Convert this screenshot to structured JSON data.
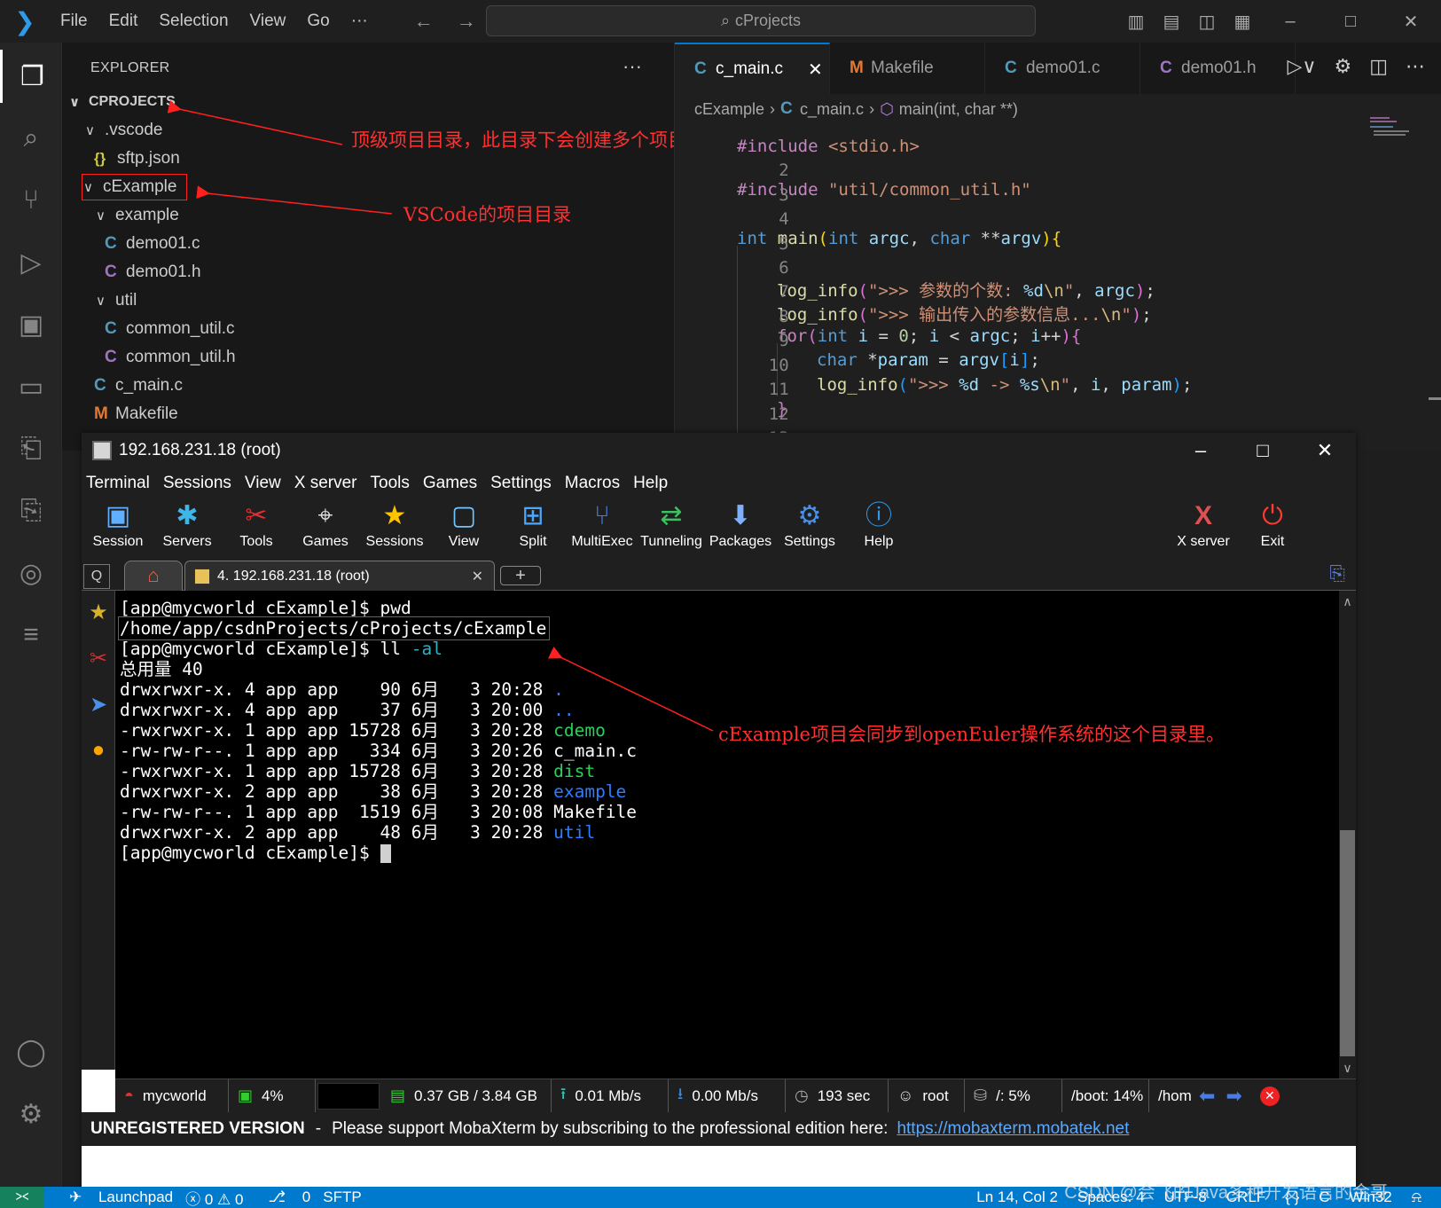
{
  "vscode": {
    "title_menu": [
      "File",
      "Edit",
      "Selection",
      "View",
      "Go",
      "···"
    ],
    "search_text": "cProjects",
    "explorer": {
      "title": "EXPLORER",
      "more": "···",
      "tree": [
        {
          "label": "CPROJECTS"
        },
        {
          "label": ".vscode"
        },
        {
          "label": "sftp.json"
        },
        {
          "label": "cExample"
        },
        {
          "label": "example"
        },
        {
          "label": "demo01.c"
        },
        {
          "label": "demo01.h"
        },
        {
          "label": "util"
        },
        {
          "label": "common_util.c"
        },
        {
          "label": "common_util.h"
        },
        {
          "label": "c_main.c"
        },
        {
          "label": "Makefile"
        }
      ]
    },
    "tabs": [
      {
        "label": "c_main.c",
        "icon": "C"
      },
      {
        "label": "Makefile",
        "icon": "M"
      },
      {
        "label": "demo01.c",
        "icon": "C"
      },
      {
        "label": "demo01.h",
        "icon": "C"
      }
    ],
    "breadcrumb": [
      "cExample",
      "c_main.c",
      "main(int, char **)"
    ],
    "line_numbers": [
      "2",
      "3",
      "4",
      "5",
      "6",
      "7",
      "8",
      "9",
      "10",
      "11",
      "12",
      "13"
    ],
    "status": {
      "launchpad": "Launchpad",
      "problems": "ⓧ 0 ⚠ 0",
      "ports": "0",
      "sftp": "SFTP",
      "position": "Ln 14, Col 2",
      "spaces": "Spaces: 4",
      "encoding": "UTF-8",
      "eol": "CRLF",
      "platform": "Win32"
    }
  },
  "annotations": {
    "top_level": "顶级项目目录，此目录下会创建多个项目",
    "vscode_project": "VSCode的项目目录",
    "sync_dir": "cExample项目会同步到openEuler操作系统的这个目录里。"
  },
  "moba": {
    "window_title": "192.168.231.18 (root)",
    "menu": [
      "Terminal",
      "Sessions",
      "View",
      "X server",
      "Tools",
      "Games",
      "Settings",
      "Macros",
      "Help"
    ],
    "toolbar": [
      {
        "label": "Session"
      },
      {
        "label": "Servers"
      },
      {
        "label": "Tools"
      },
      {
        "label": "Games"
      },
      {
        "label": "Sessions"
      },
      {
        "label": "View"
      },
      {
        "label": "Split"
      },
      {
        "label": "MultiExec"
      },
      {
        "label": "Tunneling"
      },
      {
        "label": "Packages"
      },
      {
        "label": "Settings"
      },
      {
        "label": "Help"
      },
      {
        "label": "X server"
      },
      {
        "label": "Exit"
      }
    ],
    "tab_label": "4. 192.168.231.18 (root)",
    "terminal": {
      "prompt1": "[app@mycworld cExample]$ pwd",
      "pwd_out": "/home/app/csdnProjects/cProjects/cExample",
      "prompt2_cmd": "[app@mycworld cExample]$ ll ",
      "prompt2_opt": "-al",
      "total": "总用量 40",
      "rows": [
        {
          "meta": "drwxrwxr-x. 4 app app    90 6月   3 20:28 ",
          "name": "."
        },
        {
          "meta": "drwxrwxr-x. 4 app app    37 6月   3 20:00 ",
          "name": ".."
        },
        {
          "meta": "-rwxrwxr-x. 1 app app 15728 6月   3 20:28 ",
          "name": "cdemo"
        },
        {
          "meta": "-rw-rw-r--. 1 app app   334 6月   3 20:26 ",
          "name": "c_main.c"
        },
        {
          "meta": "-rwxrwxr-x. 1 app app 15728 6月   3 20:28 ",
          "name": "dist"
        },
        {
          "meta": "drwxrwxr-x. 2 app app    38 6月   3 20:28 ",
          "name": "example"
        },
        {
          "meta": "-rw-rw-r--. 1 app app  1519 6月   3 20:08 ",
          "name": "Makefile"
        },
        {
          "meta": "drwxrwxr-x. 2 app app    48 6月   3 20:28 ",
          "name": "util"
        }
      ],
      "prompt3": "[app@mycworld cExample]$ "
    },
    "status": {
      "host": "mycworld",
      "cpu": "4%",
      "mem": "0.37 GB / 3.84 GB",
      "up": "0.01 Mb/s",
      "down": "0.00 Mb/s",
      "uptime": "193 sec",
      "user": "root",
      "disk_root": "/: 5%",
      "disk_boot": "/boot: 14%",
      "disk_home": "/hom"
    },
    "unregistered": {
      "title": "UNREGISTERED VERSION",
      "dash": "-",
      "message": "Please support MobaXterm by subscribing to the professional edition here:",
      "link": "https://mobaxterm.mobatek.net"
    }
  },
  "watermark": "CSDN @会飞的Java多种开发语言的金哥"
}
